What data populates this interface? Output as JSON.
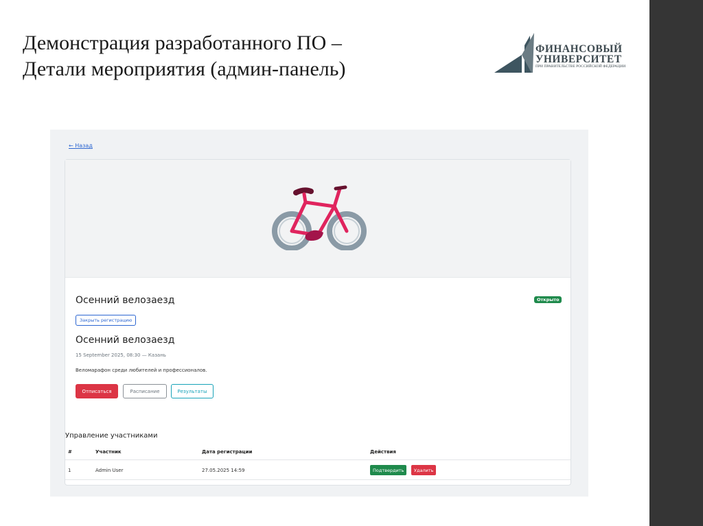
{
  "slide": {
    "title_line1": "Демонстрация разработанного ПО –",
    "title_line2": "Детали мероприятия (админ-панель)"
  },
  "logo": {
    "line1": "ФИНАНСОВЫЙ",
    "line2": "УНИВЕРСИТЕТ",
    "line3": "ПРИ ПРАВИТЕЛЬСТВЕ РОССИЙСКОЙ ФЕДЕРАЦИИ"
  },
  "app": {
    "back_label": "← Назад",
    "hero_icon": "bicycle-icon",
    "event": {
      "title": "Осенний велозаезд",
      "status_badge": "Открыто",
      "close_registration_label": "Закрыть регистрацию",
      "subtitle": "Осенний велозаезд",
      "meta": "15 September 2025, 08:30 — Казань",
      "description": "Веломарафон среди любителей и профессионалов."
    },
    "buttons": {
      "unsubscribe": "Отписаться",
      "schedule": "Расписание",
      "results": "Результаты"
    },
    "participants": {
      "heading": "Управление участниками",
      "columns": [
        "#",
        "Участник",
        "Дата регистрации",
        "Действия"
      ],
      "rows": [
        {
          "num": "1",
          "name": "Admin User",
          "date": "27.05.2025 14:59",
          "confirm_label": "Подтвердить",
          "delete_label": "Удалить"
        }
      ]
    }
  },
  "colors": {
    "accent_blue": "#2c66d1",
    "success_green": "#1f8a4c",
    "danger_red": "#dc3545",
    "info_cyan": "#17a2b8",
    "side_bar": "#353535"
  }
}
